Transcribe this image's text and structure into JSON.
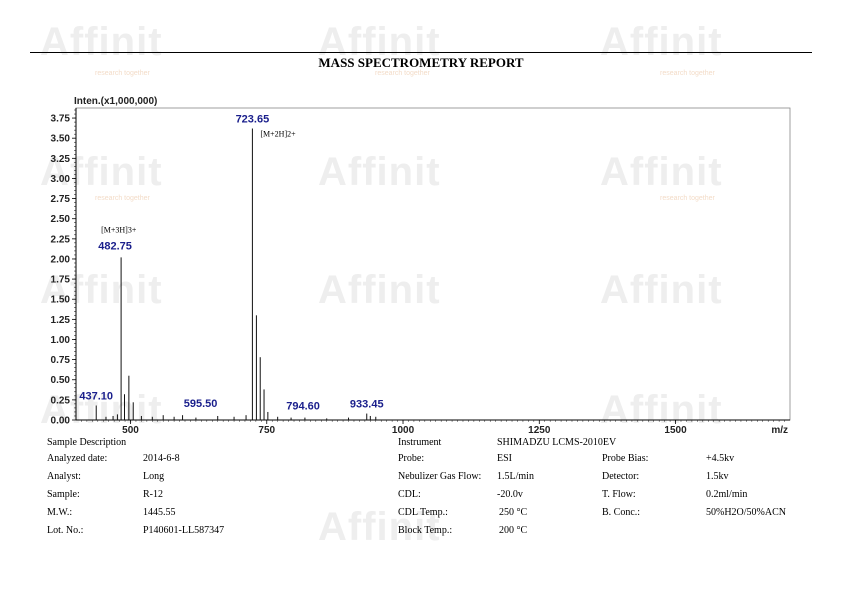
{
  "watermark": {
    "text": "Affinit",
    "tagline": "research together"
  },
  "header": {
    "title": "MASS SPECTROMETRY REPORT"
  },
  "chart_data": {
    "type": "bar",
    "ylabel": "Inten.(x1,000,000)",
    "xlabel": "m/z",
    "xlim": [
      400,
      1710
    ],
    "ylim": [
      0,
      3.875
    ],
    "x_ticks": [
      500,
      750,
      1000,
      1250,
      1500
    ],
    "y_ticks": [
      "0.00",
      "0.25",
      "0.50",
      "0.75",
      "1.00",
      "1.25",
      "1.50",
      "1.75",
      "2.00",
      "2.25",
      "2.50",
      "2.75",
      "3.00",
      "3.25",
      "3.50",
      "3.75"
    ],
    "colors": {
      "peak_label": "#1a1f8c",
      "axis": "#000000"
    },
    "peaks": [
      {
        "x": 723.65,
        "y": 3.62,
        "label": "723.65",
        "annotation": "[M+2H]2+"
      },
      {
        "x": 482.75,
        "y": 2.02,
        "label": "482.75",
        "annotation": "[M+3H]3+"
      },
      {
        "x": 437.1,
        "y": 0.18,
        "label": "437.10"
      },
      {
        "x": 595.5,
        "y": 0.06,
        "label": "595.50"
      },
      {
        "x": 794.6,
        "y": 0.03,
        "label": "794.60"
      },
      {
        "x": 933.45,
        "y": 0.08,
        "label": "933.45"
      },
      {
        "x": 497.0,
        "y": 0.55
      },
      {
        "x": 489.0,
        "y": 0.32
      },
      {
        "x": 505.0,
        "y": 0.22
      },
      {
        "x": 468.0,
        "y": 0.05
      },
      {
        "x": 455.0,
        "y": 0.04
      },
      {
        "x": 476.0,
        "y": 0.07
      },
      {
        "x": 520.0,
        "y": 0.05
      },
      {
        "x": 540.0,
        "y": 0.04
      },
      {
        "x": 560.0,
        "y": 0.06
      },
      {
        "x": 580.0,
        "y": 0.04
      },
      {
        "x": 620.0,
        "y": 0.03
      },
      {
        "x": 660.0,
        "y": 0.05
      },
      {
        "x": 690.0,
        "y": 0.04
      },
      {
        "x": 712.0,
        "y": 0.06
      },
      {
        "x": 731.0,
        "y": 1.3
      },
      {
        "x": 738.0,
        "y": 0.78
      },
      {
        "x": 745.0,
        "y": 0.38
      },
      {
        "x": 752.0,
        "y": 0.1
      },
      {
        "x": 770.0,
        "y": 0.04
      },
      {
        "x": 820.0,
        "y": 0.03
      },
      {
        "x": 860.0,
        "y": 0.02
      },
      {
        "x": 900.0,
        "y": 0.03
      },
      {
        "x": 940.0,
        "y": 0.05
      },
      {
        "x": 950.0,
        "y": 0.04
      }
    ]
  },
  "info": {
    "sample_description": "Sample Description",
    "left": [
      {
        "label": "Analyzed date:",
        "value": "2014-6-8"
      },
      {
        "label": "Analyst:",
        "value": "Long"
      },
      {
        "label": "Sample:",
        "value": "R-12"
      },
      {
        "label": "M.W.:",
        "value": "1445.55"
      },
      {
        "label": "Lot. No.:",
        "value": "P140601-LL587347"
      }
    ],
    "middle": [
      {
        "label": "Instrument",
        "value": "SHIMADZU LCMS-2010EV"
      },
      {
        "label": "Probe:",
        "value": "ESI"
      },
      {
        "label": "Nebulizer Gas Flow:",
        "value": "1.5L/min"
      },
      {
        "label": "CDL:",
        "value": "-20.0v"
      },
      {
        "label": "CDL Temp.:",
        "value": "250 °C"
      },
      {
        "label": "Block Temp.:",
        "value": "200 °C"
      }
    ],
    "right": [
      {
        "label": "Probe Bias:",
        "value": "+4.5kv"
      },
      {
        "label": "Detector:",
        "value": "1.5kv"
      },
      {
        "label": "T. Flow:",
        "value": "0.2ml/min"
      },
      {
        "label": "B. Conc.:",
        "value": "50%H2O/50%ACN"
      }
    ]
  }
}
